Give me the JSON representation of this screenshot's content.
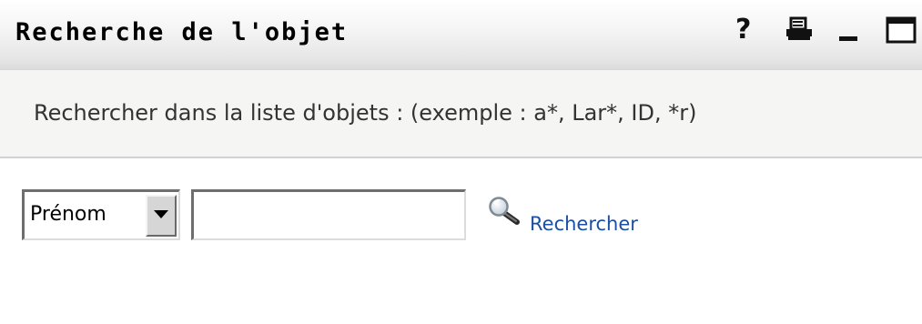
{
  "window": {
    "title": "Recherche de l'objet",
    "controls": {
      "help_label": "?",
      "print_icon": "print-icon",
      "minimize_icon": "minimize-icon",
      "maximize_icon": "maximize-icon"
    }
  },
  "instruction": {
    "text": "Rechercher dans la liste d'objets : (exemple : a*, Lar*, ID, *r)"
  },
  "search": {
    "attribute_select": {
      "selected": "Prénom"
    },
    "query_input": {
      "value": "",
      "placeholder": ""
    },
    "button": {
      "label": "Rechercher",
      "icon": "magnifier-icon"
    }
  },
  "colors": {
    "link": "#1a4fa3",
    "instruction_bg": "#f5f5f3",
    "titlebar_bg": "#e6e6e6"
  }
}
